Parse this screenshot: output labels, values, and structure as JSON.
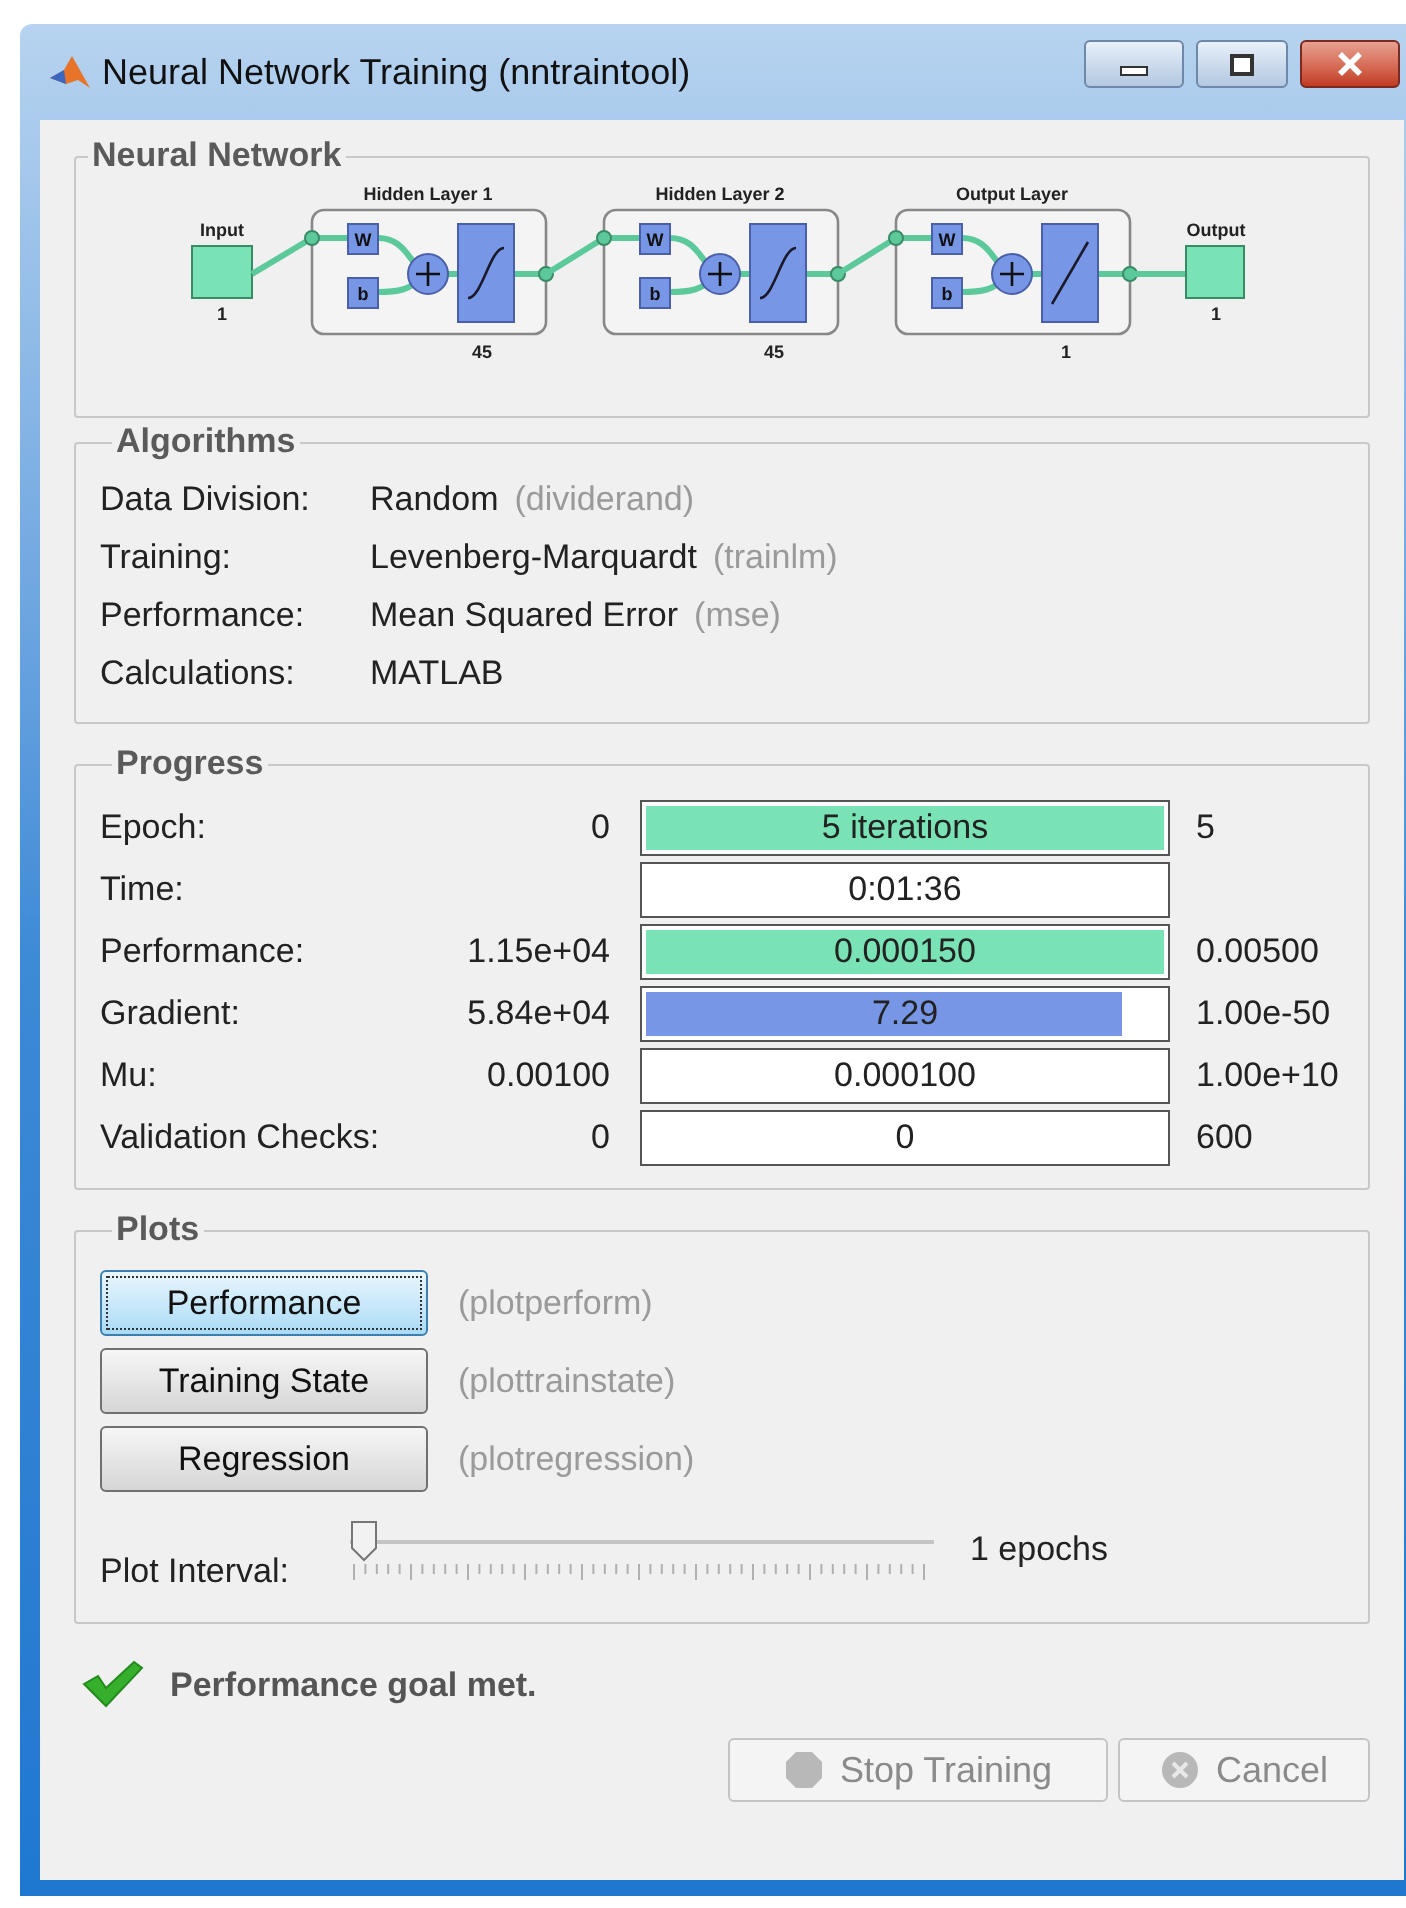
{
  "window": {
    "title": "Neural Network Training (nntraintool)"
  },
  "network": {
    "legend": "Neural Network",
    "input": {
      "label": "Input",
      "size": "1"
    },
    "layers": [
      {
        "title": "Hidden Layer 1",
        "weight": "W",
        "bias": "b",
        "size": "45",
        "kind": "sigmoid"
      },
      {
        "title": "Hidden Layer 2",
        "weight": "W",
        "bias": "b",
        "size": "45",
        "kind": "sigmoid"
      },
      {
        "title": "Output Layer",
        "weight": "W",
        "bias": "b",
        "size": "1",
        "kind": "linear"
      }
    ],
    "output": {
      "label": "Output",
      "size": "1"
    }
  },
  "algorithms": {
    "legend": "Algorithms",
    "rows": [
      {
        "label": "Data Division:",
        "value": "Random",
        "function": "(dividerand)"
      },
      {
        "label": "Training:",
        "value": "Levenberg-Marquardt",
        "function": "(trainlm)"
      },
      {
        "label": "Performance:",
        "value": "Mean Squared Error",
        "function": "(mse)"
      },
      {
        "label": "Calculations:",
        "value": "MATLAB"
      }
    ]
  },
  "progress": {
    "legend": "Progress",
    "rows": [
      {
        "label": "Epoch:",
        "start": "0",
        "value": "5 iterations",
        "end": "5",
        "fill": {
          "level": 1,
          "color": "#7ae3b5"
        }
      },
      {
        "label": "Time:",
        "value": "0:01:36"
      },
      {
        "label": "Performance:",
        "start": "1.15e+04",
        "value": "0.000150",
        "end": "0.00500",
        "fill": {
          "level": 1,
          "color": "#7ae3b5"
        }
      },
      {
        "label": "Gradient:",
        "start": "5.84e+04",
        "value": "7.29",
        "end": "1.00e-50",
        "fill": {
          "level": 0.92,
          "color": "#7896e6"
        }
      },
      {
        "label": "Mu:",
        "start": "0.00100",
        "value": "0.000100",
        "end": "1.00e+10"
      },
      {
        "label": "Validation Checks:",
        "start": "0",
        "value": "0",
        "end": "600"
      }
    ]
  },
  "plots": {
    "legend": "Plots",
    "buttons": [
      {
        "label": "Performance",
        "function": "(plotperform)",
        "selected": true
      },
      {
        "label": "Training State",
        "function": "(plottrainstate)",
        "selected": false
      },
      {
        "label": "Regression",
        "function": "(plotregression)",
        "selected": false
      }
    ],
    "interval": {
      "label": "Plot Interval:",
      "level": 0,
      "reading": "1 epochs"
    }
  },
  "status": {
    "message": "Performance goal met."
  },
  "buttons": [
    {
      "label": "Stop Training",
      "kind": "stop",
      "disabled": true
    },
    {
      "label": "Cancel",
      "kind": "cancel",
      "disabled": true
    }
  ]
}
